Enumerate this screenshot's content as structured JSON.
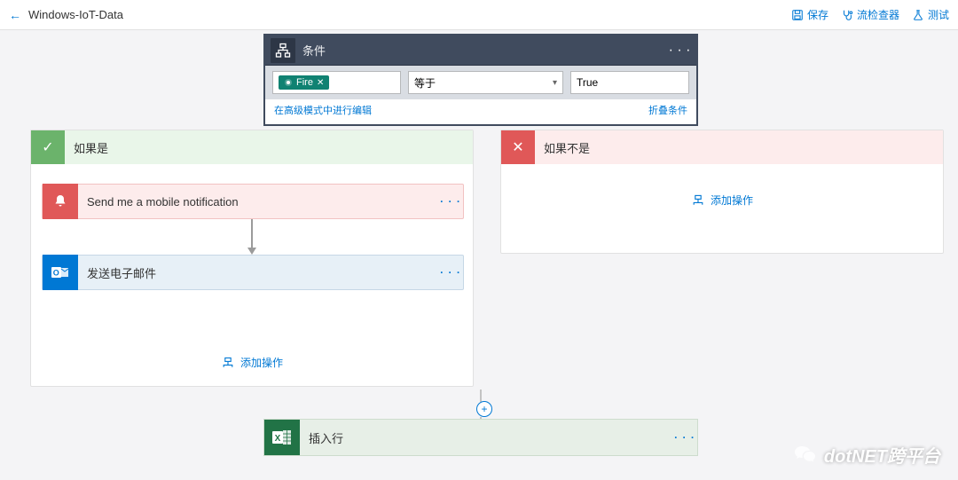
{
  "topbar": {
    "title": "Windows-IoT-Data",
    "save": "保存",
    "checker": "流检查器",
    "test": "测试"
  },
  "condition": {
    "header": "条件",
    "token": "Fire",
    "operator": "等于",
    "value": "True",
    "adv_link": "在高级模式中进行编辑",
    "collapse_link": "折叠条件"
  },
  "branches": {
    "yes_title": "如果是",
    "no_title": "如果不是",
    "add_action": "添加操作"
  },
  "actions": {
    "notify": "Send me a mobile notification",
    "mail": "发送电子邮件",
    "insert_row": "插入行"
  },
  "watermark": "dotNET跨平台"
}
